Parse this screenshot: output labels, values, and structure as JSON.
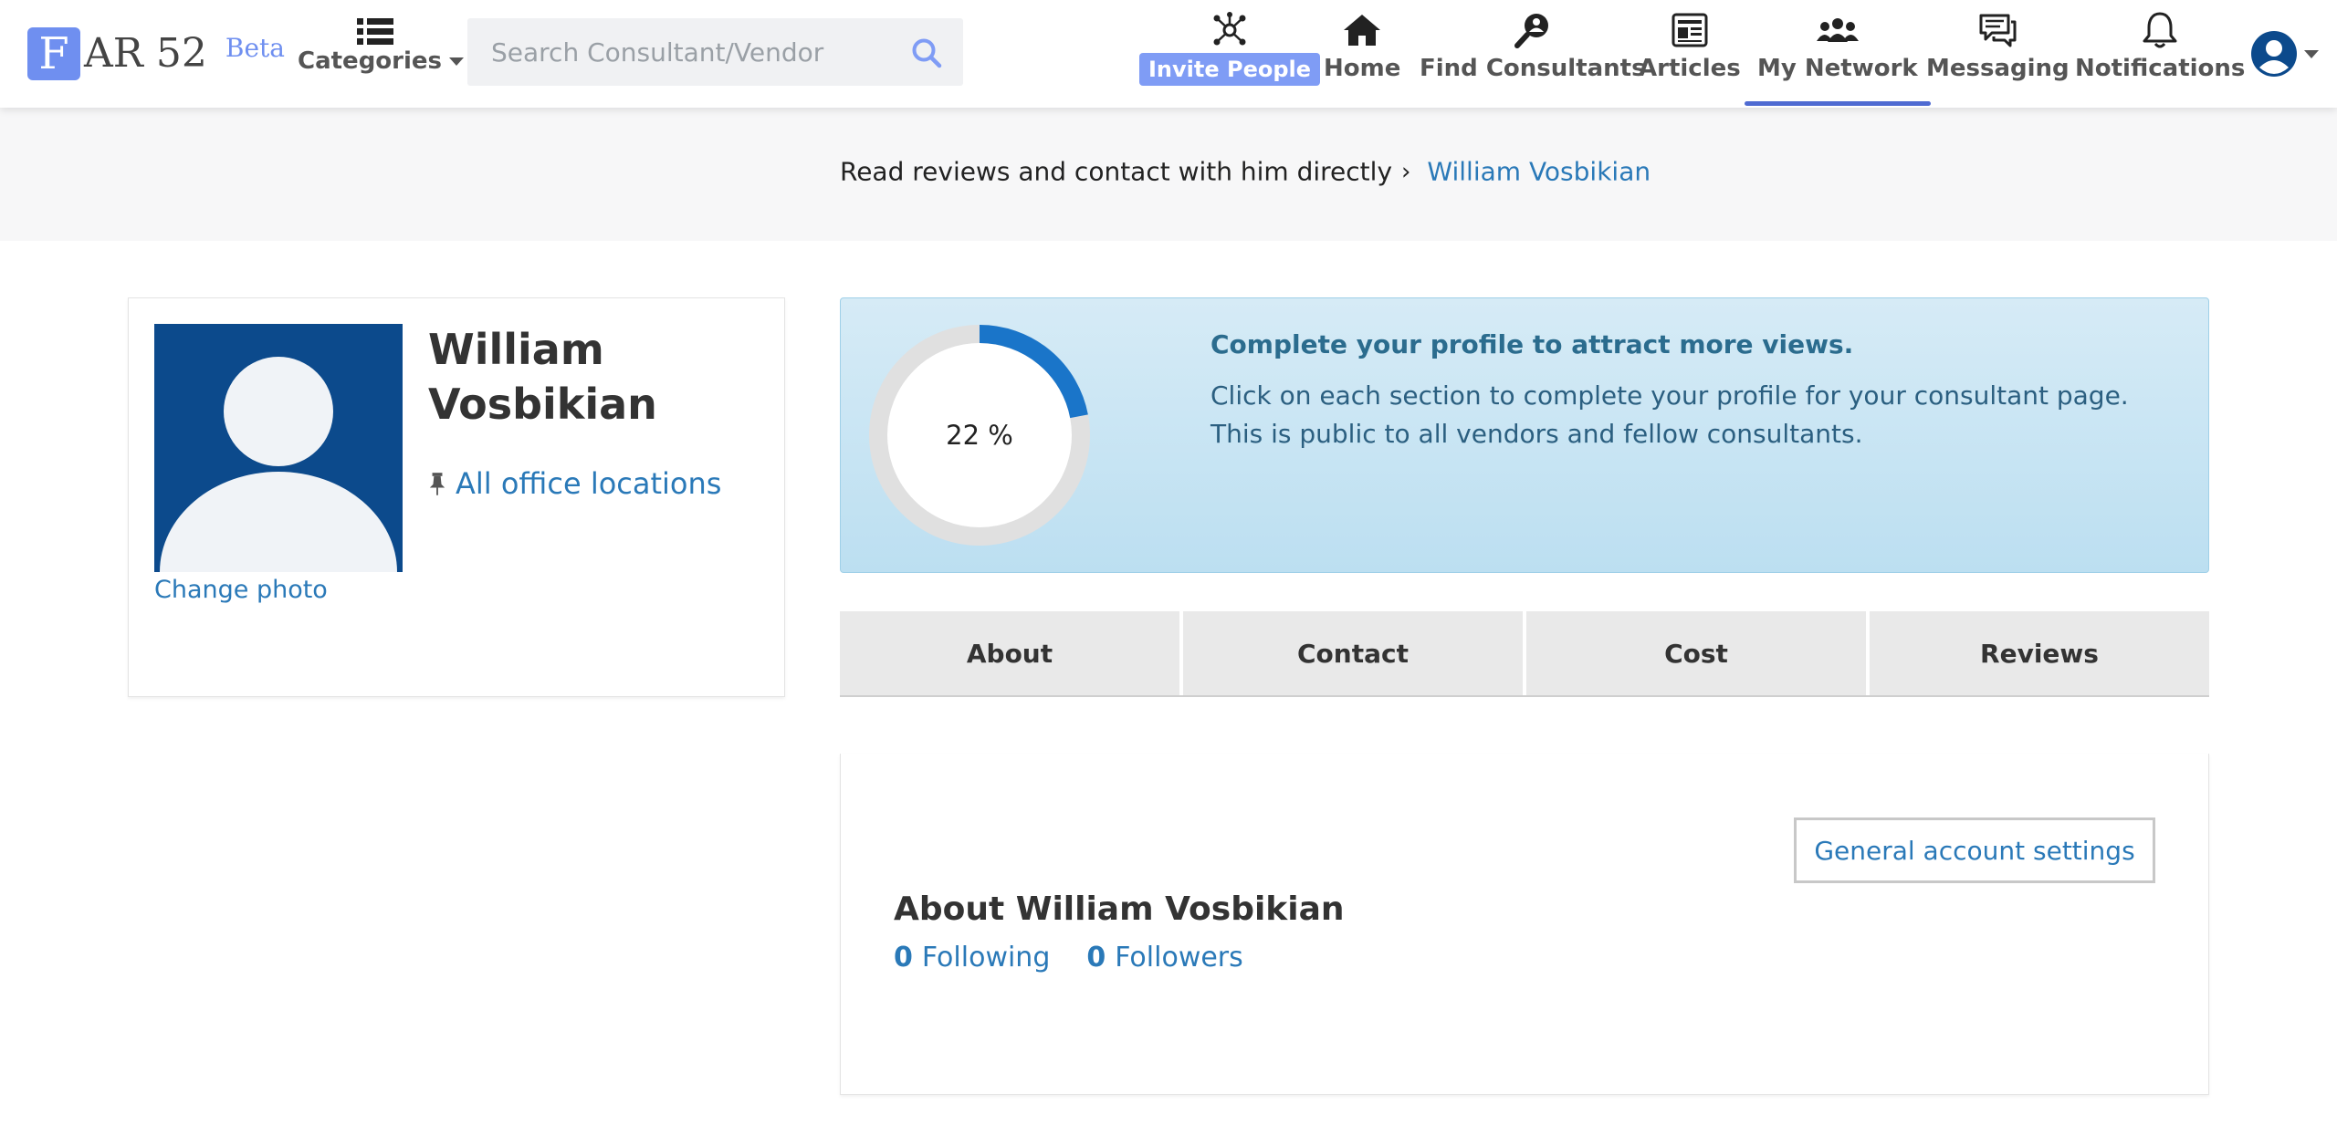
{
  "header": {
    "logo_letter": "F",
    "logo_rest": "AR 52",
    "logo_beta": "Beta",
    "categories_label": "Categories",
    "search_placeholder": "Search Consultant/Vendor",
    "invite_label": "Invite People",
    "nav": {
      "home": "Home",
      "find_consultants": "Find Consultants",
      "articles": "Articles",
      "my_network": "My Network",
      "messaging": "Messaging",
      "notifications": "Notifications"
    },
    "active_nav": "my_network",
    "accent_color": "#4f6bd2"
  },
  "breadcrumb": {
    "text": "Read reviews and contact with him directly",
    "separator": "›",
    "current": "William Vosbikian"
  },
  "profile": {
    "name": "William Vosbikian",
    "change_photo": "Change photo",
    "locations_link": "All office locations"
  },
  "completion": {
    "percent": 22,
    "percent_label": "22 %",
    "title": "Complete your profile to attract more views.",
    "text": "Click on each section to complete your profile for your consultant page. This is public to all vendors and fellow consultants.",
    "ring_color": "#1a75c9"
  },
  "tabs": [
    "About",
    "Contact",
    "Cost",
    "Reviews"
  ],
  "about": {
    "settings_button": "General account settings",
    "title": "About William Vosbikian",
    "following_count": "0",
    "following_label": "Following",
    "followers_count": "0",
    "followers_label": "Followers"
  }
}
